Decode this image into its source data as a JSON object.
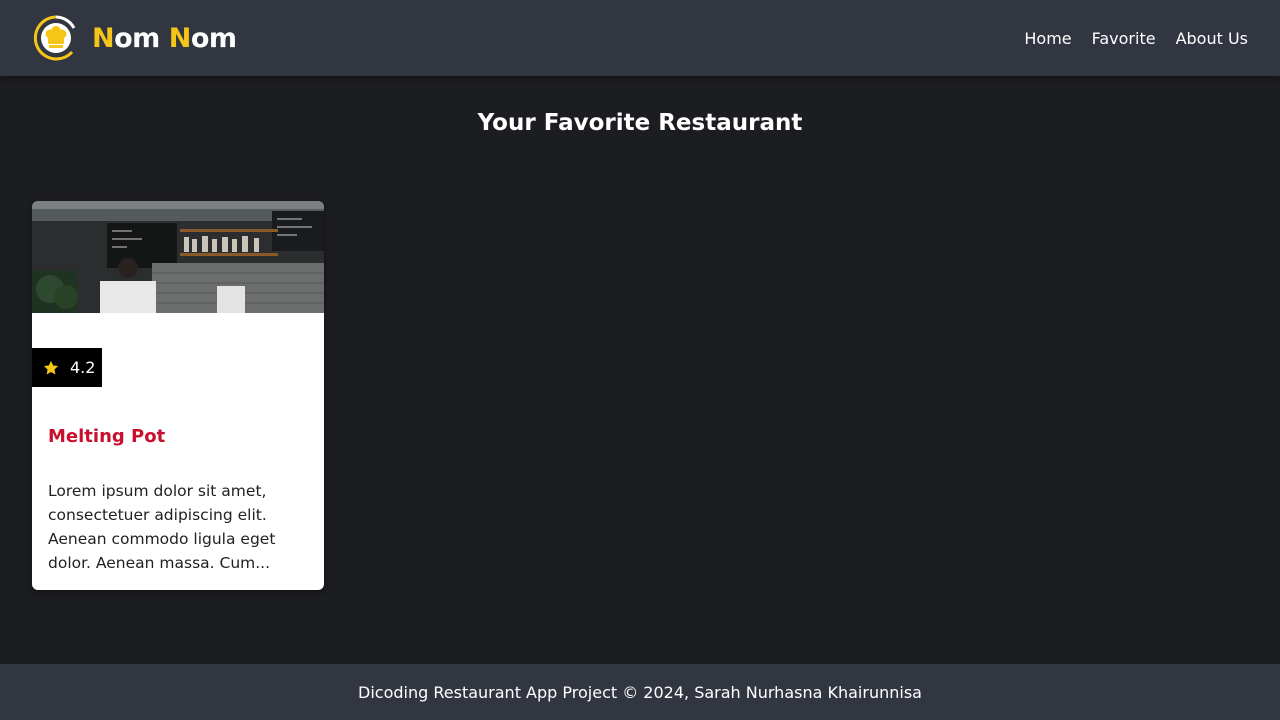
{
  "header": {
    "brand": {
      "first_letter_a": "N",
      "rest_a": "om ",
      "first_letter_b": "N",
      "rest_b": "om",
      "logo_icon": "chef-hat-icon"
    },
    "nav": [
      {
        "label": "Home"
      },
      {
        "label": "Favorite"
      },
      {
        "label": "About Us"
      }
    ]
  },
  "main": {
    "title": "Your Favorite Restaurant",
    "restaurants": [
      {
        "name": "Melting Pot",
        "rating": "4.2",
        "rating_icon": "star-icon",
        "description": "Lorem ipsum dolor sit amet, consectetuer adipiscing elit. Aenean commodo ligula eget dolor. Aenean massa. Cum..."
      }
    ]
  },
  "footer": {
    "text": "Dicoding Restaurant App Project © 2024, Sarah Nurhasna Khairunnisa"
  },
  "colors": {
    "header_bg": "#313641",
    "body_bg": "#1c1d21",
    "accent": "#f5c518",
    "title_red": "#c8102e"
  }
}
